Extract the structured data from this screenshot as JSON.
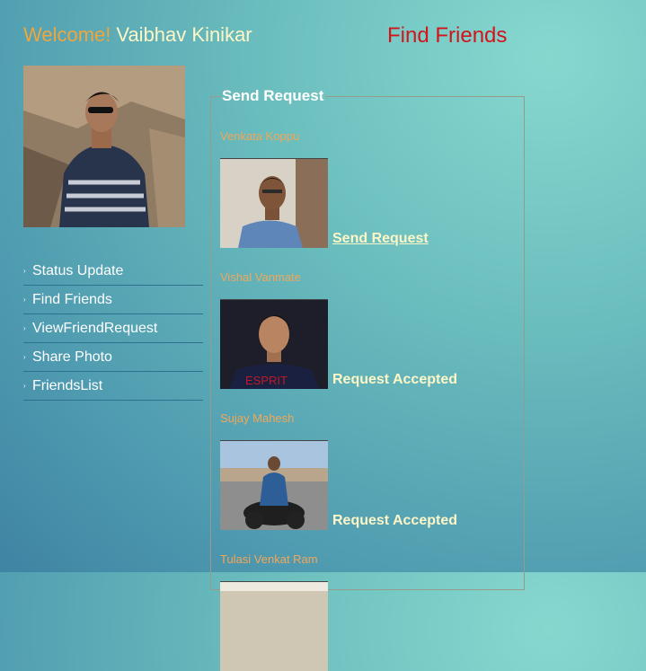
{
  "header": {
    "welcome_label": "Welcome!",
    "user_name": "Vaibhav Kinikar",
    "page_title": "Find Friends"
  },
  "nav": {
    "items": [
      {
        "label": "Status Update"
      },
      {
        "label": "Find Friends"
      },
      {
        "label": "ViewFriendRequest"
      },
      {
        "label": "Share Photo"
      },
      {
        "label": "FriendsList"
      }
    ]
  },
  "requests": {
    "legend": "Send Request",
    "friends": [
      {
        "name": "Venkata Koppu",
        "action": "Send Request"
      },
      {
        "name": "Vishal Vanmate",
        "action": "Request Accepted"
      },
      {
        "name": "Sujay Mahesh",
        "action": "Request Accepted"
      },
      {
        "name": "Tulasi Venkat Ram",
        "action": ""
      }
    ]
  },
  "colors": {
    "welcome": "#f0a63c",
    "user_name": "#fdf6c6",
    "title": "#d2141b",
    "friend_name": "#f2a65a"
  }
}
